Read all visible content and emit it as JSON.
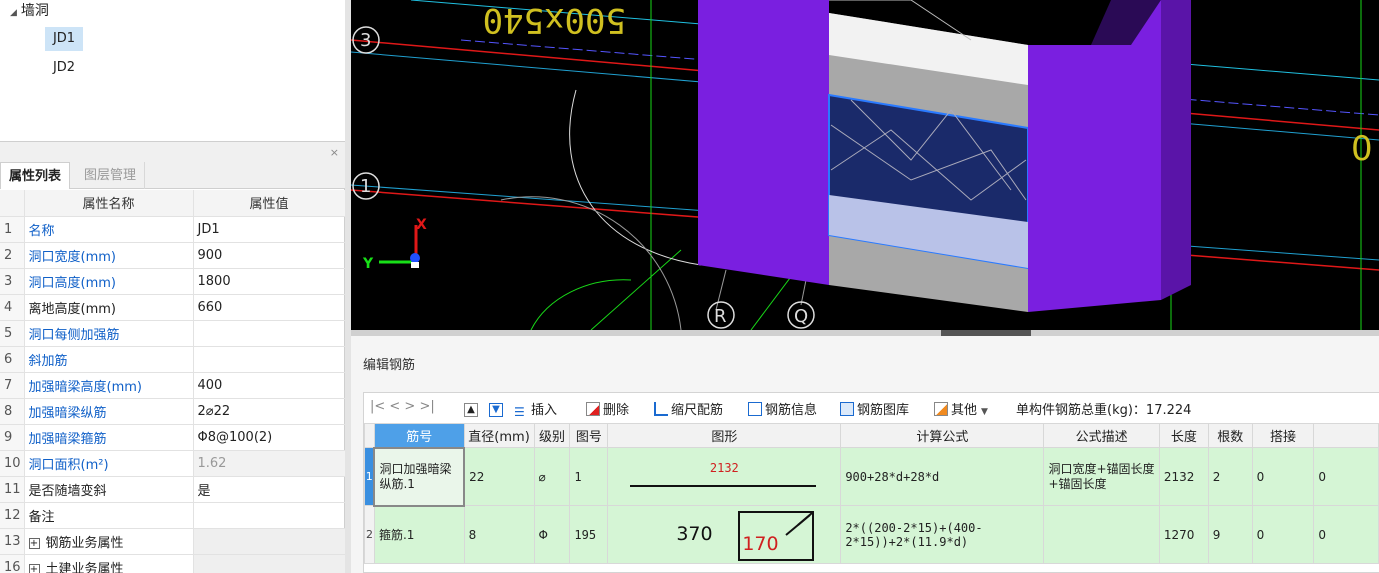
{
  "tree": {
    "root_label": "墙洞",
    "items": [
      {
        "label": "JD1",
        "selected": true
      },
      {
        "label": "JD2",
        "selected": false
      }
    ]
  },
  "panel": {
    "tab_properties": "属性列表",
    "tab_layers": "图层管理",
    "close_glyph": "×"
  },
  "props": {
    "header_name": "属性名称",
    "header_value": "属性值",
    "rows": [
      {
        "n": "1",
        "key": "名称",
        "value": "JD1"
      },
      {
        "n": "2",
        "key": "洞口宽度(mm)",
        "value": "900"
      },
      {
        "n": "3",
        "key": "洞口高度(mm)",
        "value": "1800"
      },
      {
        "n": "4",
        "key": "离地高度(mm)",
        "value": "660"
      },
      {
        "n": "5",
        "key": "洞口每侧加强筋",
        "value": ""
      },
      {
        "n": "6",
        "key": "斜加筋",
        "value": ""
      },
      {
        "n": "7",
        "key": "加强暗梁高度(mm)",
        "value": "400"
      },
      {
        "n": "8",
        "key": "加强暗梁纵筋",
        "value": "2⌀22"
      },
      {
        "n": "9",
        "key": "加强暗梁箍筋",
        "value": "Φ8@100(2)"
      },
      {
        "n": "10",
        "key": "洞口面积(m²)",
        "value": "1.62"
      },
      {
        "n": "11",
        "key": "是否随墙变斜",
        "value": "是"
      },
      {
        "n": "12",
        "key": "备注",
        "value": ""
      },
      {
        "n": "13",
        "key": "钢筋业务属性",
        "value": ""
      },
      {
        "n": "16",
        "key": "土建业务属性",
        "value": ""
      }
    ]
  },
  "cad": {
    "label_3": "3",
    "label_1": "1",
    "label_R": "R",
    "label_Q": "Q",
    "top_text": "500x540",
    "axis_x": "X",
    "axis_y": "Y"
  },
  "rebar": {
    "title": "编辑钢筋",
    "toolbar": {
      "nav": "|<  <  >  >|",
      "insert": "插入",
      "delete": "删除",
      "scale": "缩尺配筋",
      "info": "钢筋信息",
      "library": "钢筋图库",
      "other": "其他",
      "total_weight": "单构件钢筋总重(kg)：17.224"
    },
    "columns": [
      "筋号",
      "直径(mm)",
      "级别",
      "图号",
      "图形",
      "计算公式",
      "公式描述",
      "长度",
      "根数",
      "搭接"
    ],
    "rows": [
      {
        "rn": "1",
        "name": "洞口加强暗梁纵筋.1",
        "diameter": "22",
        "grade": "⌀",
        "fig_no": "1",
        "shape_value": "2132",
        "formula": "900+28*d+28*d",
        "desc": "洞口宽度+锚固长度+锚固长度",
        "length": "2132",
        "count": "2",
        "lap": "0"
      },
      {
        "rn": "2",
        "name": "箍筋.1",
        "diameter": "8",
        "grade": "Φ",
        "fig_no": "195",
        "shape_w": "370",
        "shape_h": "170",
        "formula": "2*((200-2*15)+(400-2*15))+2*(11.9*d)",
        "desc": "",
        "length": "1270",
        "count": "9",
        "lap": "0"
      }
    ]
  },
  "colors": {
    "wall_purple": "#7a1fe0",
    "wall_dark": "#5a14a8",
    "beam_white": "#f2f2f2",
    "beam_gray": "#a8a8a8",
    "opening_blue": "#1a2a6a",
    "sill_lavender": "#b9c2e8",
    "axis_red": "#e01818",
    "axis_green": "#18e018",
    "grid_row_green": "#d5f5d5",
    "header_blue": "#4ea0e8"
  }
}
